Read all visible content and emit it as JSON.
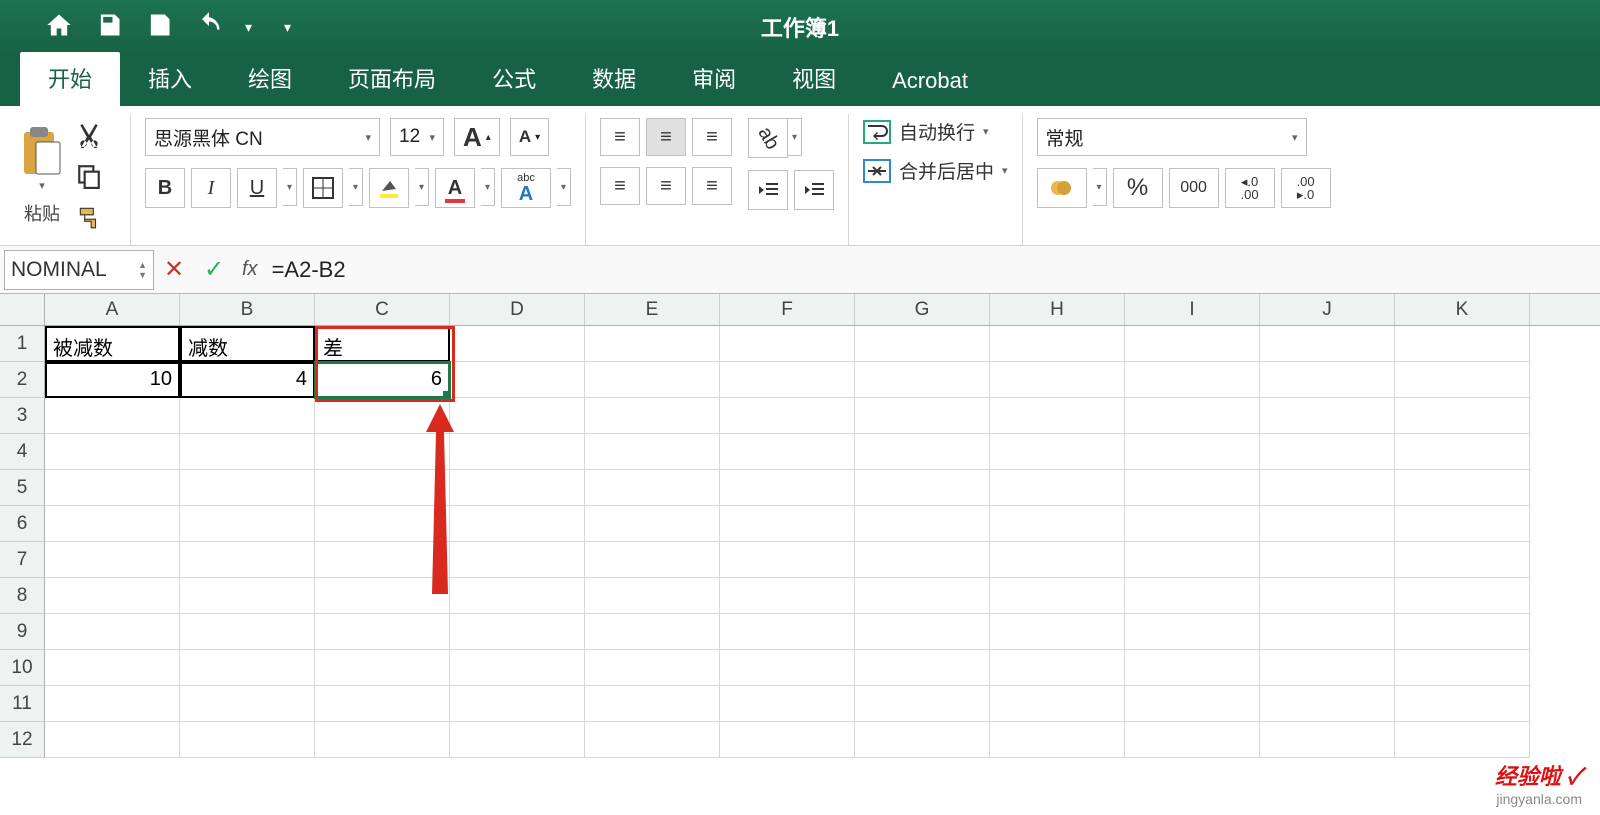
{
  "app": {
    "title": "工作簿1"
  },
  "tabs": [
    "开始",
    "插入",
    "绘图",
    "页面布局",
    "公式",
    "数据",
    "审阅",
    "视图",
    "Acrobat"
  ],
  "active_tab": 0,
  "ribbon": {
    "paste_label": "粘贴",
    "font_name": "思源黑体 CN",
    "font_size": "12",
    "wrap_label": "自动换行",
    "merge_label": "合并后居中",
    "number_format": "常规",
    "phonetic": "abc"
  },
  "formula_bar": {
    "name_box": "NOMINAL",
    "formula": "=A2-B2"
  },
  "columns": [
    "A",
    "B",
    "C",
    "D",
    "E",
    "F",
    "G",
    "H",
    "I",
    "J",
    "K"
  ],
  "rows": [
    1,
    2,
    3,
    4,
    5,
    6,
    7,
    8,
    9,
    10,
    11,
    12
  ],
  "cells": {
    "A1": "被减数",
    "B1": "减数",
    "C1": "差",
    "A2": "10",
    "B2": "4",
    "C2": "6"
  },
  "watermark": {
    "brand": "经验啦 ✓",
    "url": "jingyanla.com"
  }
}
